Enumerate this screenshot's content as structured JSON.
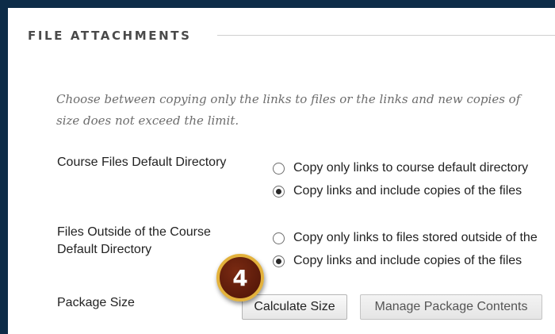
{
  "section": {
    "title": "FILE ATTACHMENTS"
  },
  "instructions": {
    "line1": "Choose between copying only the links to files or the links and new copies of",
    "line2": "size does not exceed the limit."
  },
  "course_files": {
    "label": "Course Files Default Directory",
    "options": [
      {
        "label": "Copy only links to course default directory",
        "selected": false
      },
      {
        "label": "Copy links and include copies of the files",
        "selected": true
      }
    ]
  },
  "outside_files": {
    "label_line1": "Files Outside of the Course",
    "label_line2": "Default Directory",
    "options": [
      {
        "label": "Copy only links to files stored outside of the",
        "selected": false
      },
      {
        "label": "Copy links and include copies of the files",
        "selected": true
      }
    ]
  },
  "package_size": {
    "label": "Package Size",
    "calculate_button": "Calculate Size",
    "manage_button": "Manage Package Contents"
  },
  "step_badge": {
    "number": "4",
    "color": "#5a1a0a",
    "ring_color": "#e3b23c"
  },
  "colors": {
    "frame": "#0d2c48"
  }
}
